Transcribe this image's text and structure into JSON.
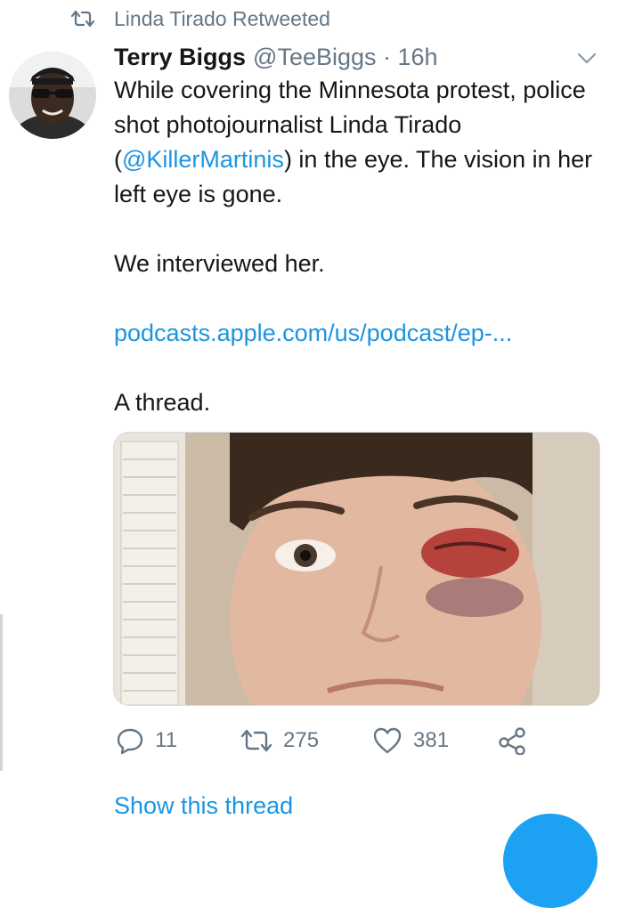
{
  "retweet_context": {
    "label": "Linda Tirado Retweeted"
  },
  "tweet": {
    "author_name": "Terry Biggs",
    "handle_time": "@TeeBiggs · 16h",
    "text": {
      "line1": "While covering the Minnesota protest, police shot photojournalist Linda Tirado (",
      "mention": "@KillerMartinis",
      "line1_end": ") in the eye. The vision in her left eye is gone.",
      "para2": "We interviewed her.",
      "link": "podcasts.apple.com/us/podcast/ep-...",
      "para4": "A thread."
    }
  },
  "actions": {
    "reply_count": "11",
    "retweet_count": "275",
    "like_count": "381"
  },
  "show_thread": "Show this thread",
  "icons": {
    "retweet_context": "retweet-icon",
    "more": "chevron-down-icon",
    "reply": "comment-icon",
    "retweet": "retweet-icon",
    "like": "heart-icon",
    "share": "share-icon"
  },
  "colors": {
    "link": "#1b95e0",
    "secondary_text": "#657786",
    "fab": "#1da1f2"
  }
}
